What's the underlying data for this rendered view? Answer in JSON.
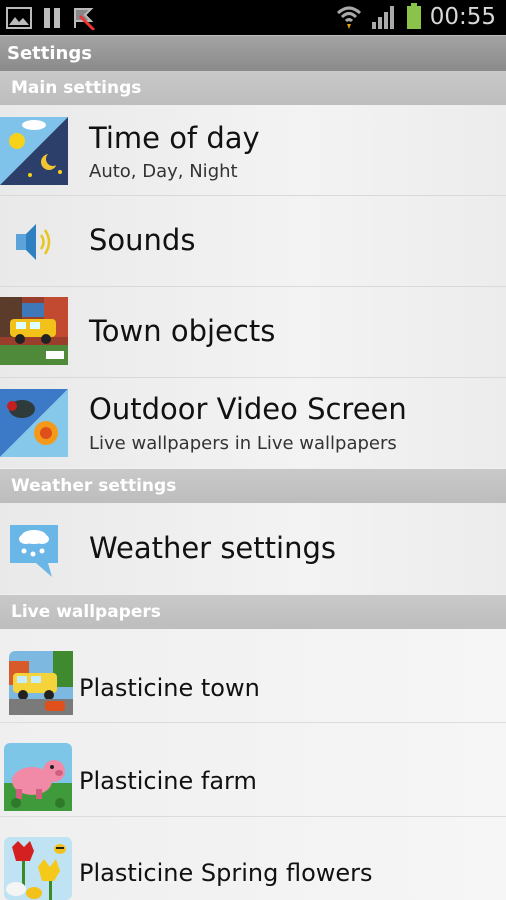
{
  "status_bar": {
    "time": "00:55",
    "icons": [
      "gallery-icon",
      "pause-icon",
      "flag-icon",
      "wifi-icon",
      "signal-icon",
      "battery-icon"
    ]
  },
  "title_bar": {
    "title": "Settings"
  },
  "sections": {
    "main": "Main settings",
    "weather": "Weather settings",
    "live": "Live wallpapers"
  },
  "main_items": [
    {
      "title": "Time of day",
      "subtitle": "Auto, Day, Night",
      "icon": "day-night-icon"
    },
    {
      "title": "Sounds",
      "subtitle": "",
      "icon": "speaker-icon"
    },
    {
      "title": "Town objects",
      "subtitle": "",
      "icon": "town-objects-icon"
    },
    {
      "title": "Outdoor Video Screen",
      "subtitle": "Live wallpapers in Live wallpapers",
      "icon": "outdoor-screen-icon"
    }
  ],
  "weather_items": [
    {
      "title": "Weather settings",
      "icon": "weather-cloud-icon"
    }
  ],
  "wallpaper_items": [
    {
      "title": "Plasticine town",
      "icon": "plasticine-town-icon"
    },
    {
      "title": "Plasticine farm",
      "icon": "plasticine-farm-icon"
    },
    {
      "title": "Plasticine Spring flowers",
      "icon": "plasticine-flowers-icon"
    }
  ],
  "colors": {
    "status_bar": "#000000",
    "title_bar": "#959595",
    "section_header": "#c4c4c4",
    "row_bg": "#efefef"
  }
}
